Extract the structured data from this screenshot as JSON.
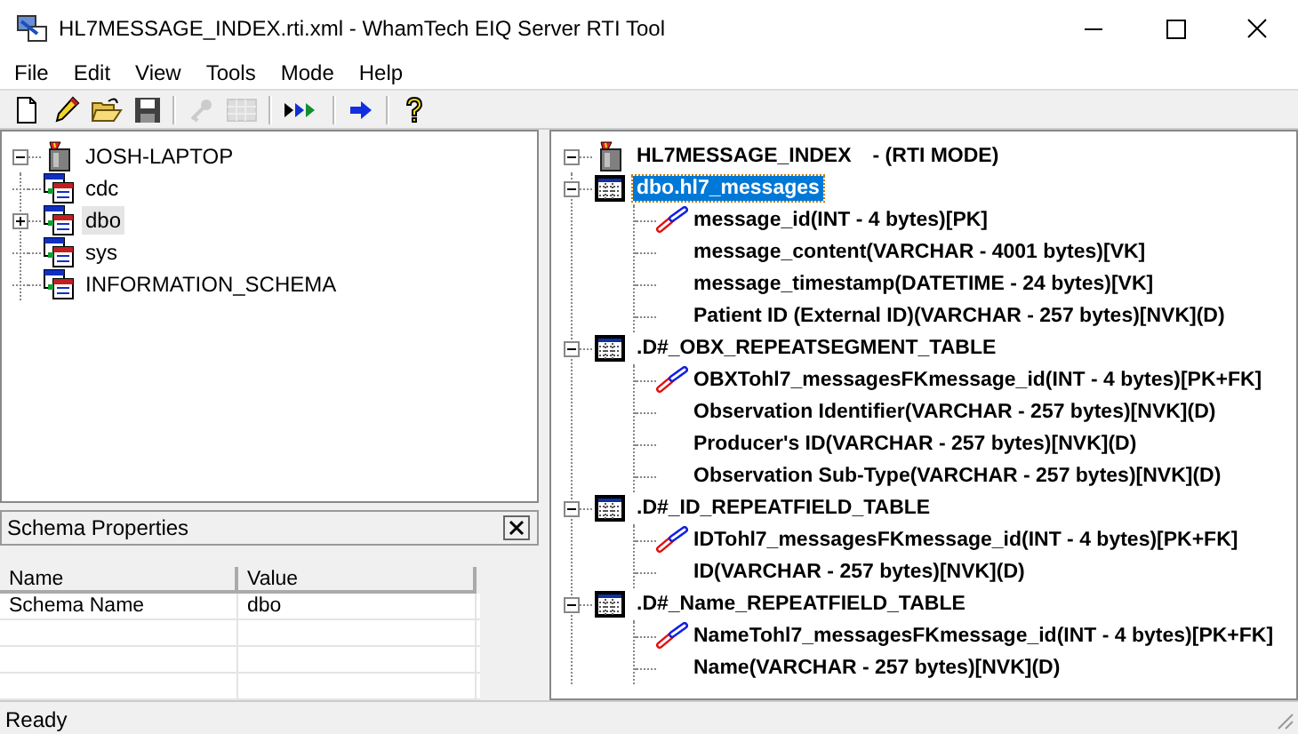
{
  "window": {
    "title": "HL7MESSAGE_INDEX.rti.xml - WhamTech EIQ Server RTI Tool"
  },
  "menu": [
    "File",
    "Edit",
    "View",
    "Tools",
    "Mode",
    "Help"
  ],
  "toolbar": [
    {
      "kind": "new",
      "disabled": false
    },
    {
      "kind": "pencil",
      "disabled": false
    },
    {
      "kind": "open",
      "disabled": false
    },
    {
      "kind": "save",
      "disabled": false
    },
    {
      "kind": "separator"
    },
    {
      "kind": "key",
      "disabled": true
    },
    {
      "kind": "grid",
      "disabled": true
    },
    {
      "kind": "separator"
    },
    {
      "kind": "run",
      "disabled": false
    },
    {
      "kind": "separator"
    },
    {
      "kind": "arrow",
      "disabled": false
    },
    {
      "kind": "separator"
    },
    {
      "kind": "help",
      "disabled": false
    }
  ],
  "server_tree": {
    "label": "JOSH-LAPTOP",
    "expanded": true,
    "children": [
      {
        "label": "cdc",
        "expandable": false,
        "selected": false
      },
      {
        "label": "dbo",
        "expandable": true,
        "selected": true
      },
      {
        "label": "sys",
        "expandable": false,
        "selected": false
      },
      {
        "label": "INFORMATION_SCHEMA",
        "expandable": false,
        "selected": false
      }
    ]
  },
  "schema_properties": {
    "title": "Schema Properties",
    "columns": [
      "Name",
      "Value"
    ],
    "rows": [
      [
        "Schema Name",
        "dbo"
      ]
    ]
  },
  "index_tree": {
    "label": "HL7MESSAGE_INDEX",
    "mode": "- (RTI MODE)",
    "expanded": true,
    "tables": [
      {
        "name": "dbo.hl7_messages",
        "selected": true,
        "expanded": true,
        "columns": [
          {
            "label": "message_id(INT - 4 bytes)[PK]",
            "key": true
          },
          {
            "label": "message_content(VARCHAR - 4001 bytes)[VK]",
            "key": false
          },
          {
            "label": "message_timestamp(DATETIME - 24 bytes)[VK]",
            "key": false
          },
          {
            "label": "Patient ID (External ID)(VARCHAR - 257 bytes)[NVK](D)",
            "key": false
          }
        ]
      },
      {
        "name": ".D#_OBX_REPEATSEGMENT_TABLE",
        "selected": false,
        "expanded": true,
        "columns": [
          {
            "label": "OBXTohl7_messagesFKmessage_id(INT - 4 bytes)[PK+FK]",
            "key": true
          },
          {
            "label": "Observation Identifier(VARCHAR - 257 bytes)[NVK](D)",
            "key": false
          },
          {
            "label": "Producer's ID(VARCHAR - 257 bytes)[NVK](D)",
            "key": false
          },
          {
            "label": "Observation Sub-Type(VARCHAR - 257 bytes)[NVK](D)",
            "key": false
          }
        ]
      },
      {
        "name": ".D#_ID_REPEATFIELD_TABLE",
        "selected": false,
        "expanded": true,
        "columns": [
          {
            "label": "IDTohl7_messagesFKmessage_id(INT - 4 bytes)[PK+FK]",
            "key": true
          },
          {
            "label": "ID(VARCHAR - 257 bytes)[NVK](D)",
            "key": false
          }
        ]
      },
      {
        "name": ".D#_Name_REPEATFIELD_TABLE",
        "selected": false,
        "expanded": true,
        "columns": [
          {
            "label": "NameTohl7_messagesFKmessage_id(INT - 4 bytes)[PK+FK]",
            "key": true
          },
          {
            "label": "Name(VARCHAR - 257 bytes)[NVK](D)",
            "key": false
          }
        ]
      }
    ]
  },
  "status_bar": "Ready"
}
